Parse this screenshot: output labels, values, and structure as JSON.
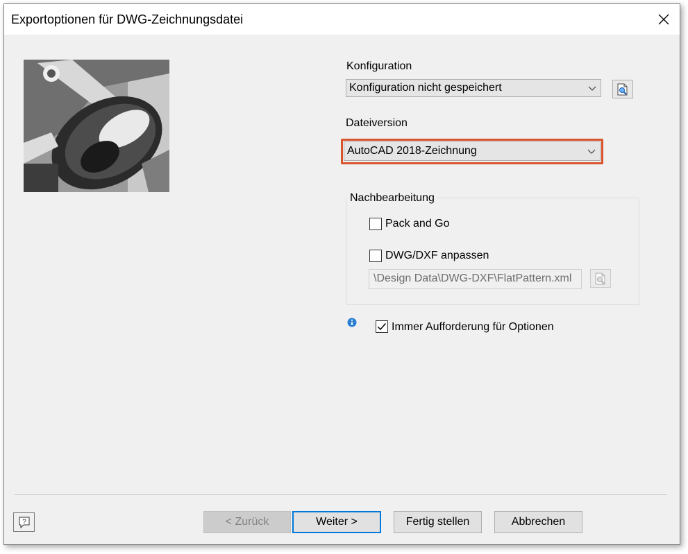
{
  "window": {
    "title": "Exportoptionen für DWG-Zeichnungsdatei"
  },
  "configuration": {
    "label": "Konfiguration",
    "selected": "Konfiguration nicht gespeichert"
  },
  "file_version": {
    "label": "Dateiversion",
    "selected": "AutoCAD 2018-Zeichnung"
  },
  "postprocessing": {
    "title": "Nachbearbeitung",
    "pack_and_go": {
      "label": "Pack and Go",
      "checked": false
    },
    "customize": {
      "label": "DWG/DXF anpassen",
      "checked": false
    },
    "path": "\\Design Data\\DWG-DXF\\FlatPattern.xml"
  },
  "always_prompt": {
    "label": "Immer Aufforderung für Optionen",
    "checked": true
  },
  "buttons": {
    "back": "< Zurück",
    "next": "Weiter >",
    "finish": "Fertig stellen",
    "cancel": "Abbrechen"
  },
  "colors": {
    "highlight": "#d9532c",
    "info": "#2a7fd4",
    "default_button_border": "#0078d7"
  },
  "icons": [
    "close-icon",
    "chevron-down-icon",
    "browse-file-icon",
    "info-icon",
    "checkmark-icon",
    "help-icon"
  ]
}
